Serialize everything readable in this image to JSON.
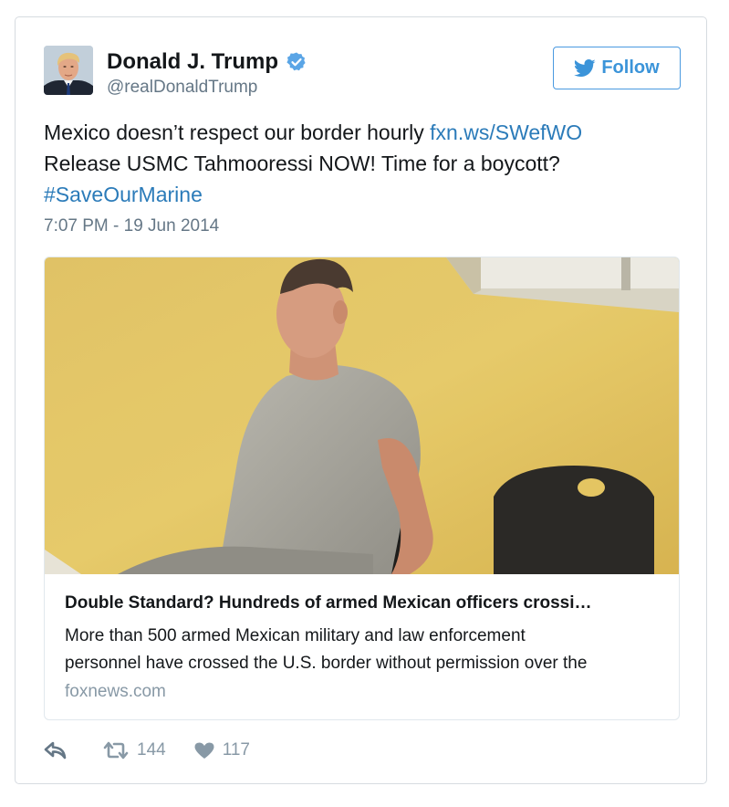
{
  "author": {
    "name": "Donald J. Trump",
    "handle": "@realDonaldTrump",
    "verified": true
  },
  "follow_button": {
    "label": "Follow",
    "icon": "twitter-bird-icon",
    "color": "#3b94d9"
  },
  "tweet": {
    "line1_text": "Mexico doesn’t respect our border hourly ",
    "line1_link": "fxn.ws/SWefWO",
    "line2_text": "Release USMC Tahmooressi NOW! Time for a boycott?",
    "hashtag": "#SaveOurMarine",
    "timestamp": "7:07 PM - 19 Jun 2014",
    "link_color": "#2b7bb9"
  },
  "card": {
    "title": "Double Standard? Hundreds of armed Mexican officers crossi…",
    "description_line1": "More than 500 armed Mexican military and law enforcement",
    "description_line2": "personnel have crossed the U.S. border without permission over the",
    "domain": "foxnews.com"
  },
  "actions": {
    "reply_icon": "reply-icon",
    "retweet_icon": "retweet-icon",
    "retweet_count": "144",
    "like_icon": "heart-icon",
    "like_count": "117"
  }
}
